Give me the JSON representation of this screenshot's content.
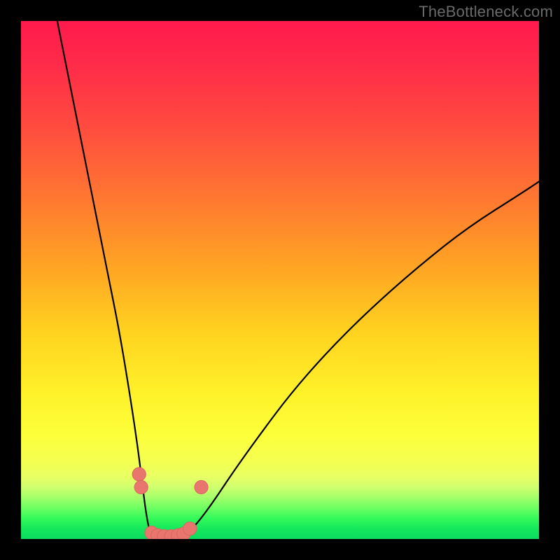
{
  "watermark": "TheBottleneck.com",
  "colors": {
    "background": "#000000",
    "gradient_top": "#ff1a4d",
    "gradient_mid1": "#ff7a30",
    "gradient_mid2": "#fff22a",
    "gradient_bottom": "#0bdc5f",
    "curve_stroke": "#000000",
    "dot_fill": "#e8766e"
  },
  "chart_data": {
    "type": "line",
    "title": "",
    "xlabel": "",
    "ylabel": "",
    "xlim": [
      0,
      100
    ],
    "ylim": [
      0,
      100
    ],
    "note": "Axes unlabeled; V-shaped bottleneck curve. Values read as percentages of plot width/height from bottom-left origin.",
    "series": [
      {
        "name": "left-branch",
        "x": [
          7,
          9,
          11,
          13,
          15,
          17,
          19,
          21,
          22.5,
          23.5,
          24,
          24.5,
          25
        ],
        "y": [
          100,
          90,
          80,
          70,
          60,
          50,
          40,
          28,
          18,
          10,
          6,
          3,
          0.8
        ]
      },
      {
        "name": "valley-floor",
        "x": [
          25,
          26,
          27,
          28,
          29,
          30,
          31,
          32
        ],
        "y": [
          0.8,
          0.4,
          0.3,
          0.3,
          0.3,
          0.4,
          0.6,
          1.0
        ]
      },
      {
        "name": "right-branch",
        "x": [
          32,
          34,
          37,
          41,
          46,
          52,
          59,
          67,
          76,
          86,
          97,
          100
        ],
        "y": [
          1.0,
          3,
          7,
          13,
          20,
          28,
          36,
          44,
          52,
          60,
          67,
          69
        ]
      }
    ],
    "markers": [
      {
        "x": 22.8,
        "y": 12.5,
        "r": 1.3
      },
      {
        "x": 23.2,
        "y": 10.0,
        "r": 1.3
      },
      {
        "x": 25.2,
        "y": 1.2,
        "r": 1.3
      },
      {
        "x": 26.4,
        "y": 0.7,
        "r": 1.3
      },
      {
        "x": 27.6,
        "y": 0.5,
        "r": 1.3
      },
      {
        "x": 29.0,
        "y": 0.5,
        "r": 1.3
      },
      {
        "x": 30.3,
        "y": 0.7,
        "r": 1.3
      },
      {
        "x": 31.4,
        "y": 1.0,
        "r": 1.3
      },
      {
        "x": 32.6,
        "y": 2.0,
        "r": 1.3
      },
      {
        "x": 34.8,
        "y": 10.0,
        "r": 1.3
      }
    ]
  }
}
